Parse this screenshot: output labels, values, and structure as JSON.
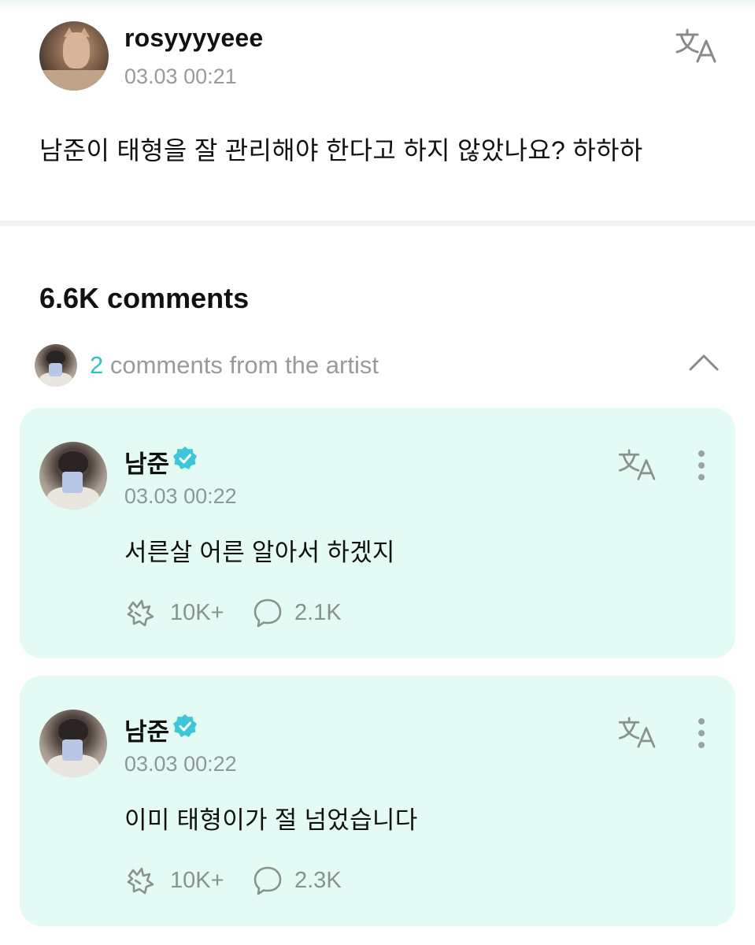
{
  "post": {
    "author": "rosyyyyeee",
    "timestamp": "03.03 00:21",
    "body": "남준이 태형을 잘 관리해야 한다고 하지 않았나요? 하하하",
    "translate_icon": "translate-icon"
  },
  "comments_header": {
    "count_label": "6.6K comments"
  },
  "artist_comments": {
    "count": "2",
    "label": " comments from the artist",
    "toggle_icon": "chevron-up-icon"
  },
  "comments": [
    {
      "author": "남준",
      "verified": true,
      "timestamp": "03.03 00:22",
      "text": "서른살 어른 알아서 하겠지",
      "likes": "10K+",
      "replies": "2.1K"
    },
    {
      "author": "남준",
      "verified": true,
      "timestamp": "03.03 00:22",
      "text": "이미 태형이가 절 넘었습니다",
      "likes": "10K+",
      "replies": "2.3K"
    }
  ],
  "colors": {
    "accent": "#2ec4c9",
    "card_bg": "#e4faf5",
    "verified": "#3bc7d8",
    "muted_text": "#9a9a9a"
  }
}
